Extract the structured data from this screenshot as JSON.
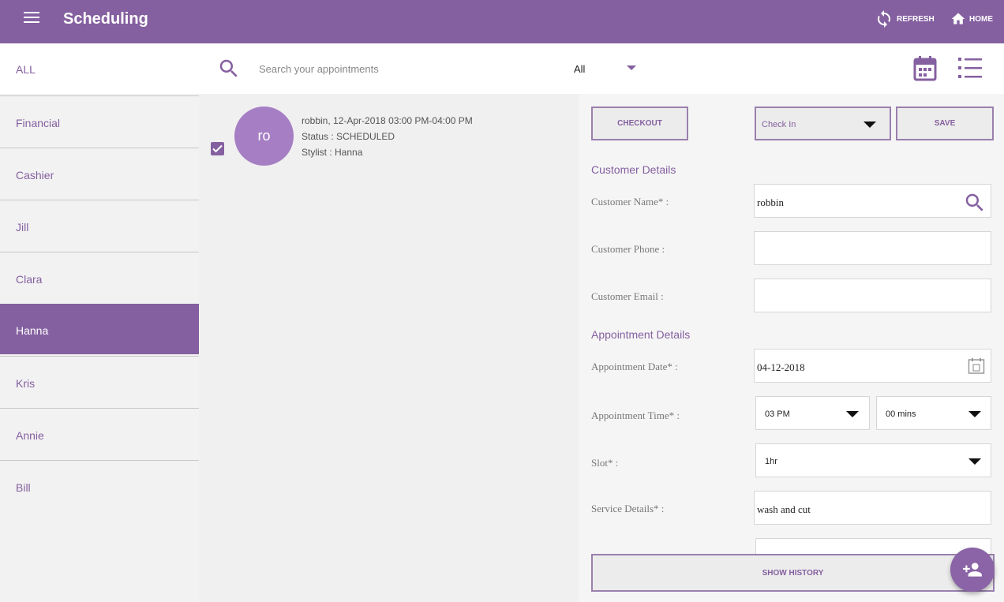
{
  "appbar": {
    "title": "Scheduling",
    "refresh_label": "REFRESH",
    "home_label": "HOME"
  },
  "search": {
    "filter_all": "ALL",
    "placeholder": "Search your appointments",
    "status_value": "All"
  },
  "sidebar": {
    "items": [
      {
        "label": "Financial",
        "active": false
      },
      {
        "label": "Cashier",
        "active": false
      },
      {
        "label": "Jill",
        "active": false
      },
      {
        "label": "Clara",
        "active": false
      },
      {
        "label": "Hanna",
        "active": true
      },
      {
        "label": "Kris",
        "active": false
      },
      {
        "label": "Annie",
        "active": false
      },
      {
        "label": "Bill",
        "active": false
      }
    ]
  },
  "appointments": [
    {
      "initials": "ro",
      "summary": "robbin, 12-Apr-2018 03:00 PM-04:00 PM",
      "status": "Status : SCHEDULED",
      "stylist": "Stylist : Hanna",
      "checked": true
    }
  ],
  "details": {
    "checkout_label": "CHECKOUT",
    "checkin_value": "Check In",
    "save_label": "SAVE",
    "customer_section": "Customer Details",
    "customer_name_label": "Customer Name* :",
    "customer_name_value": "robbin",
    "customer_phone_label": "Customer Phone :",
    "customer_phone_value": "",
    "customer_email_label": "Customer Email :",
    "customer_email_value": "",
    "appointment_section": "Appointment Details",
    "date_label": "Appointment Date* :",
    "date_value": "04-12-2018",
    "time_label": "Appointment Time* :",
    "hour_value": "03 PM",
    "minute_value": "00 mins",
    "slot_label": "Slot* :",
    "slot_value": "1hr",
    "service_label": "Service Details* :",
    "service_value": "wash and cut",
    "history_label": "SHOW HISTORY"
  },
  "colors": {
    "primary": "#8560a0",
    "avatar": "#a67ec4",
    "accent_fab": "#8a64a6"
  },
  "icons": [
    "menu-icon",
    "refresh-icon",
    "home-icon",
    "search-icon",
    "calendar-icon",
    "list-icon",
    "checkbox-checked-icon",
    "calendar-picker-icon",
    "chevron-down-icon",
    "add-person-icon"
  ]
}
